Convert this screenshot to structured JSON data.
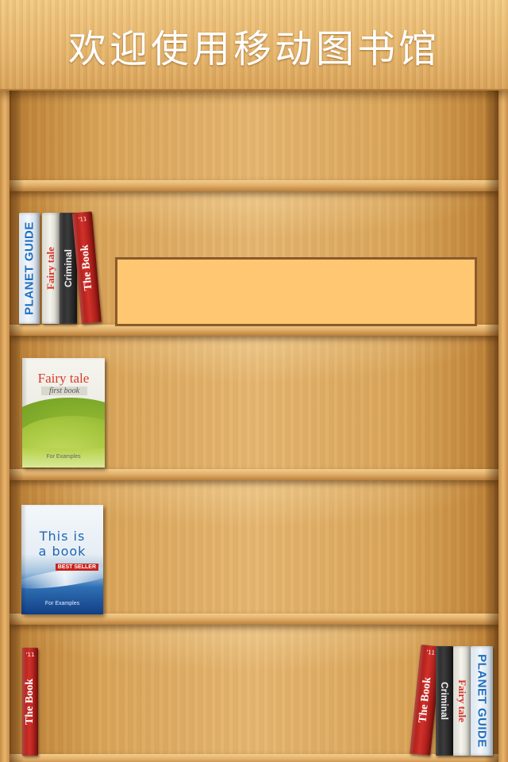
{
  "header": {
    "title": "欢迎使用移动图书馆"
  },
  "colors": {
    "wood_light": "#e6b772",
    "wood_dark": "#b7792f",
    "info_panel_fill": "#ffc771",
    "info_panel_border": "#8b5a2b"
  },
  "shelves": [
    {
      "row": 1,
      "items": []
    },
    {
      "row": 2,
      "items": [
        {
          "kind": "spine",
          "style": "blue",
          "title": "PLANET GUIDE"
        },
        {
          "kind": "spine",
          "style": "white",
          "title": "Fairy tale"
        },
        {
          "kind": "spine",
          "style": "dark",
          "title": "Criminal"
        },
        {
          "kind": "spine",
          "style": "red",
          "title": "The Book",
          "year": "'11"
        }
      ],
      "info_panel": {
        "text": ""
      }
    },
    {
      "row": 3,
      "items": [
        {
          "kind": "cover",
          "title": "Fairy tale",
          "subtitle": "first book",
          "footer": "For Examples"
        }
      ]
    },
    {
      "row": 4,
      "items": [
        {
          "kind": "cover",
          "title_line1": "This is",
          "title_line2": "a book",
          "badge": "BEST SELLER",
          "footer": "For Examples"
        }
      ]
    },
    {
      "row": 5,
      "left_items": [
        {
          "kind": "spine",
          "style": "red",
          "title": "The Book",
          "year": "'11"
        }
      ],
      "right_items": [
        {
          "kind": "spine",
          "style": "red",
          "title": "The Book",
          "year": "'11"
        },
        {
          "kind": "spine",
          "style": "dark",
          "title": "Criminal"
        },
        {
          "kind": "spine",
          "style": "white",
          "title": "Fairy tale"
        },
        {
          "kind": "spine",
          "style": "blue",
          "title": "PLANET GUIDE"
        }
      ]
    }
  ]
}
